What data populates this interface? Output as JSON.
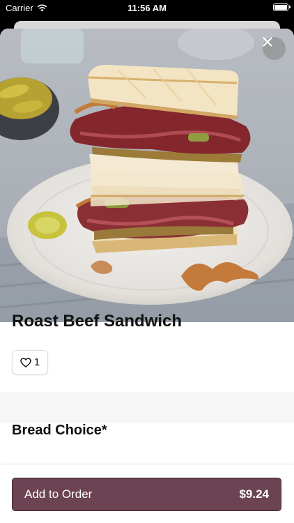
{
  "status_bar": {
    "carrier": "Carrier",
    "time": "11:56 AM",
    "icons": [
      "wifi-icon",
      "battery-icon"
    ]
  },
  "item": {
    "title": "Roast Beef Sandwich",
    "like_count": "1",
    "image_alt": "Roast beef sandwich on a plate"
  },
  "sections": [
    {
      "title": "Bread Choice*"
    }
  ],
  "footer": {
    "add_label": "Add to Order",
    "price": "$9.24"
  },
  "colors": {
    "accent": "#6b4352",
    "background": "#ffffff",
    "section_gap": "#f6f6f6"
  },
  "icons": {
    "close": "close-icon",
    "like": "heart-icon"
  }
}
